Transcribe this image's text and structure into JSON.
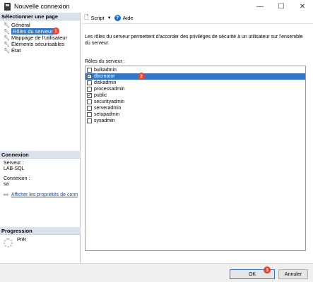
{
  "window": {
    "title": "Nouvelle connexion",
    "controls": {
      "minimize": "—",
      "maximize": "☐",
      "close": "✕"
    }
  },
  "sidebar": {
    "header": "Sélectionner une page",
    "items": [
      {
        "label": "Général",
        "icon": "wrench-icon"
      },
      {
        "label": "Rôles du serveur",
        "icon": "wrench-icon",
        "selected": true
      },
      {
        "label": "Mappage de l'utilisateur",
        "icon": "wrench-icon"
      },
      {
        "label": "Éléments sécurisables",
        "icon": "wrench-icon"
      },
      {
        "label": "État",
        "icon": "wrench-icon"
      }
    ],
    "badge": "1"
  },
  "connection": {
    "header": "Connexion",
    "server_label": "Serveur :",
    "server_value": "LAB-SQL",
    "connection_label": "Connexion :",
    "connection_value": "sa",
    "link": "Afficher les propriétés de conn"
  },
  "progress": {
    "header": "Progression",
    "status": "Prêt"
  },
  "toolbar": {
    "script_label": "Script",
    "help_label": "Aide"
  },
  "main": {
    "description": "Les rôles du serveur permettent d'accorder des privilèges de sécurité à un utilisateur sur l'ensemble du serveur.",
    "roles_label": "Rôles du serveur :",
    "roles": [
      {
        "name": "bulkadmin",
        "checked": false
      },
      {
        "name": "dbcreator",
        "checked": true,
        "selected": true
      },
      {
        "name": "diskadmin",
        "checked": false
      },
      {
        "name": "processadmin",
        "checked": false
      },
      {
        "name": "public",
        "checked": true
      },
      {
        "name": "securityadmin",
        "checked": false
      },
      {
        "name": "serveradmin",
        "checked": false
      },
      {
        "name": "setupadmin",
        "checked": false
      },
      {
        "name": "sysadmin",
        "checked": false
      }
    ],
    "badge": "2"
  },
  "footer": {
    "ok_label": "OK",
    "cancel_label": "Annuler",
    "badge": "3"
  },
  "colors": {
    "selection": "#3277c7",
    "section_header": "#dbe2ec",
    "badge": "#e8432d",
    "link": "#1a4fa3"
  }
}
